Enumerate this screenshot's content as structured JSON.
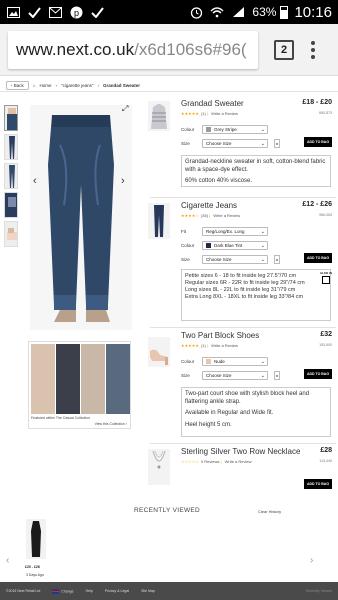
{
  "status": {
    "battery": "63%",
    "time": "10:16"
  },
  "browser": {
    "url_domain": "www.next.co.uk",
    "url_path": "/x6d106s6#96(",
    "tab_count": "2"
  },
  "breadcrumb": {
    "back": "Back",
    "home": "Home",
    "level1": "\"cigarette jeans\"",
    "current": "Grandad Sweater"
  },
  "featured": {
    "label": "Featured within The Casual Collection",
    "link": "View this Collection"
  },
  "labels": {
    "colour": "Colour",
    "size": "Size",
    "fit": "Fit",
    "add_to_bag": "ADD TO BAG",
    "write_review": "Write a Review",
    "also_in": "ALSO IN"
  },
  "products": [
    {
      "name": "Grandad Sweater",
      "price": "£18 - £20",
      "reviews": "(1)",
      "code": "890-873",
      "colour": "Grey Stripe",
      "colour_hex": "#9b9b9b",
      "size": "Choose Size",
      "desc": [
        "Grandad-neckline sweater in soft, cotton-blend fabric with a space-dye effect.",
        "60% cotton 40% viscose."
      ]
    },
    {
      "name": "Cigarette Jeans",
      "price": "£12 - £26",
      "reviews": "(35)",
      "code": "966-063",
      "fit": "Reg/Long/Ex. Long",
      "colour": "Dark Blue Tint",
      "colour_hex": "#1f2a44",
      "size": "Choose Size",
      "desc": [
        "Petite sizes 6 - 18 to fit inside leg 27.5\"/70 cm",
        "Regular sizes 6R - 22R to fit inside leg 29\"/74 cm",
        "Long sizes 8L - 22L to fit inside leg 31\"/79 cm",
        "Extra Long 8XL - 18XL to fit inside leg 33\"/84 cm"
      ]
    },
    {
      "name": "Two Part Block Shoes",
      "price": "£32",
      "reviews": "(1)",
      "code": "153-900",
      "colour": "Nude",
      "colour_hex": "#e7c7b0",
      "size": "Choose Size",
      "desc": [
        "Two-part court shoe with stylish block heel and flattering ankle strap.",
        "Available in Regular and Wide fit.",
        "Heel height 5 cm."
      ]
    },
    {
      "name": "Sterling Silver Two Row Necklace",
      "price": "£28",
      "reviews": "0 Reviews",
      "code": "113-440"
    }
  ],
  "recent": {
    "title": "RECENTLY VIEWED",
    "clear": "Clear History",
    "price": "£20 - £26",
    "ago": "3 Days Ago"
  },
  "footer": {
    "copyright": "©2015 Next Retail Ltd",
    "change": "Change",
    "help": "Help",
    "privacy": "Privacy & Legal",
    "sitemap": "Site Map",
    "recently": "Recently Viewed"
  }
}
